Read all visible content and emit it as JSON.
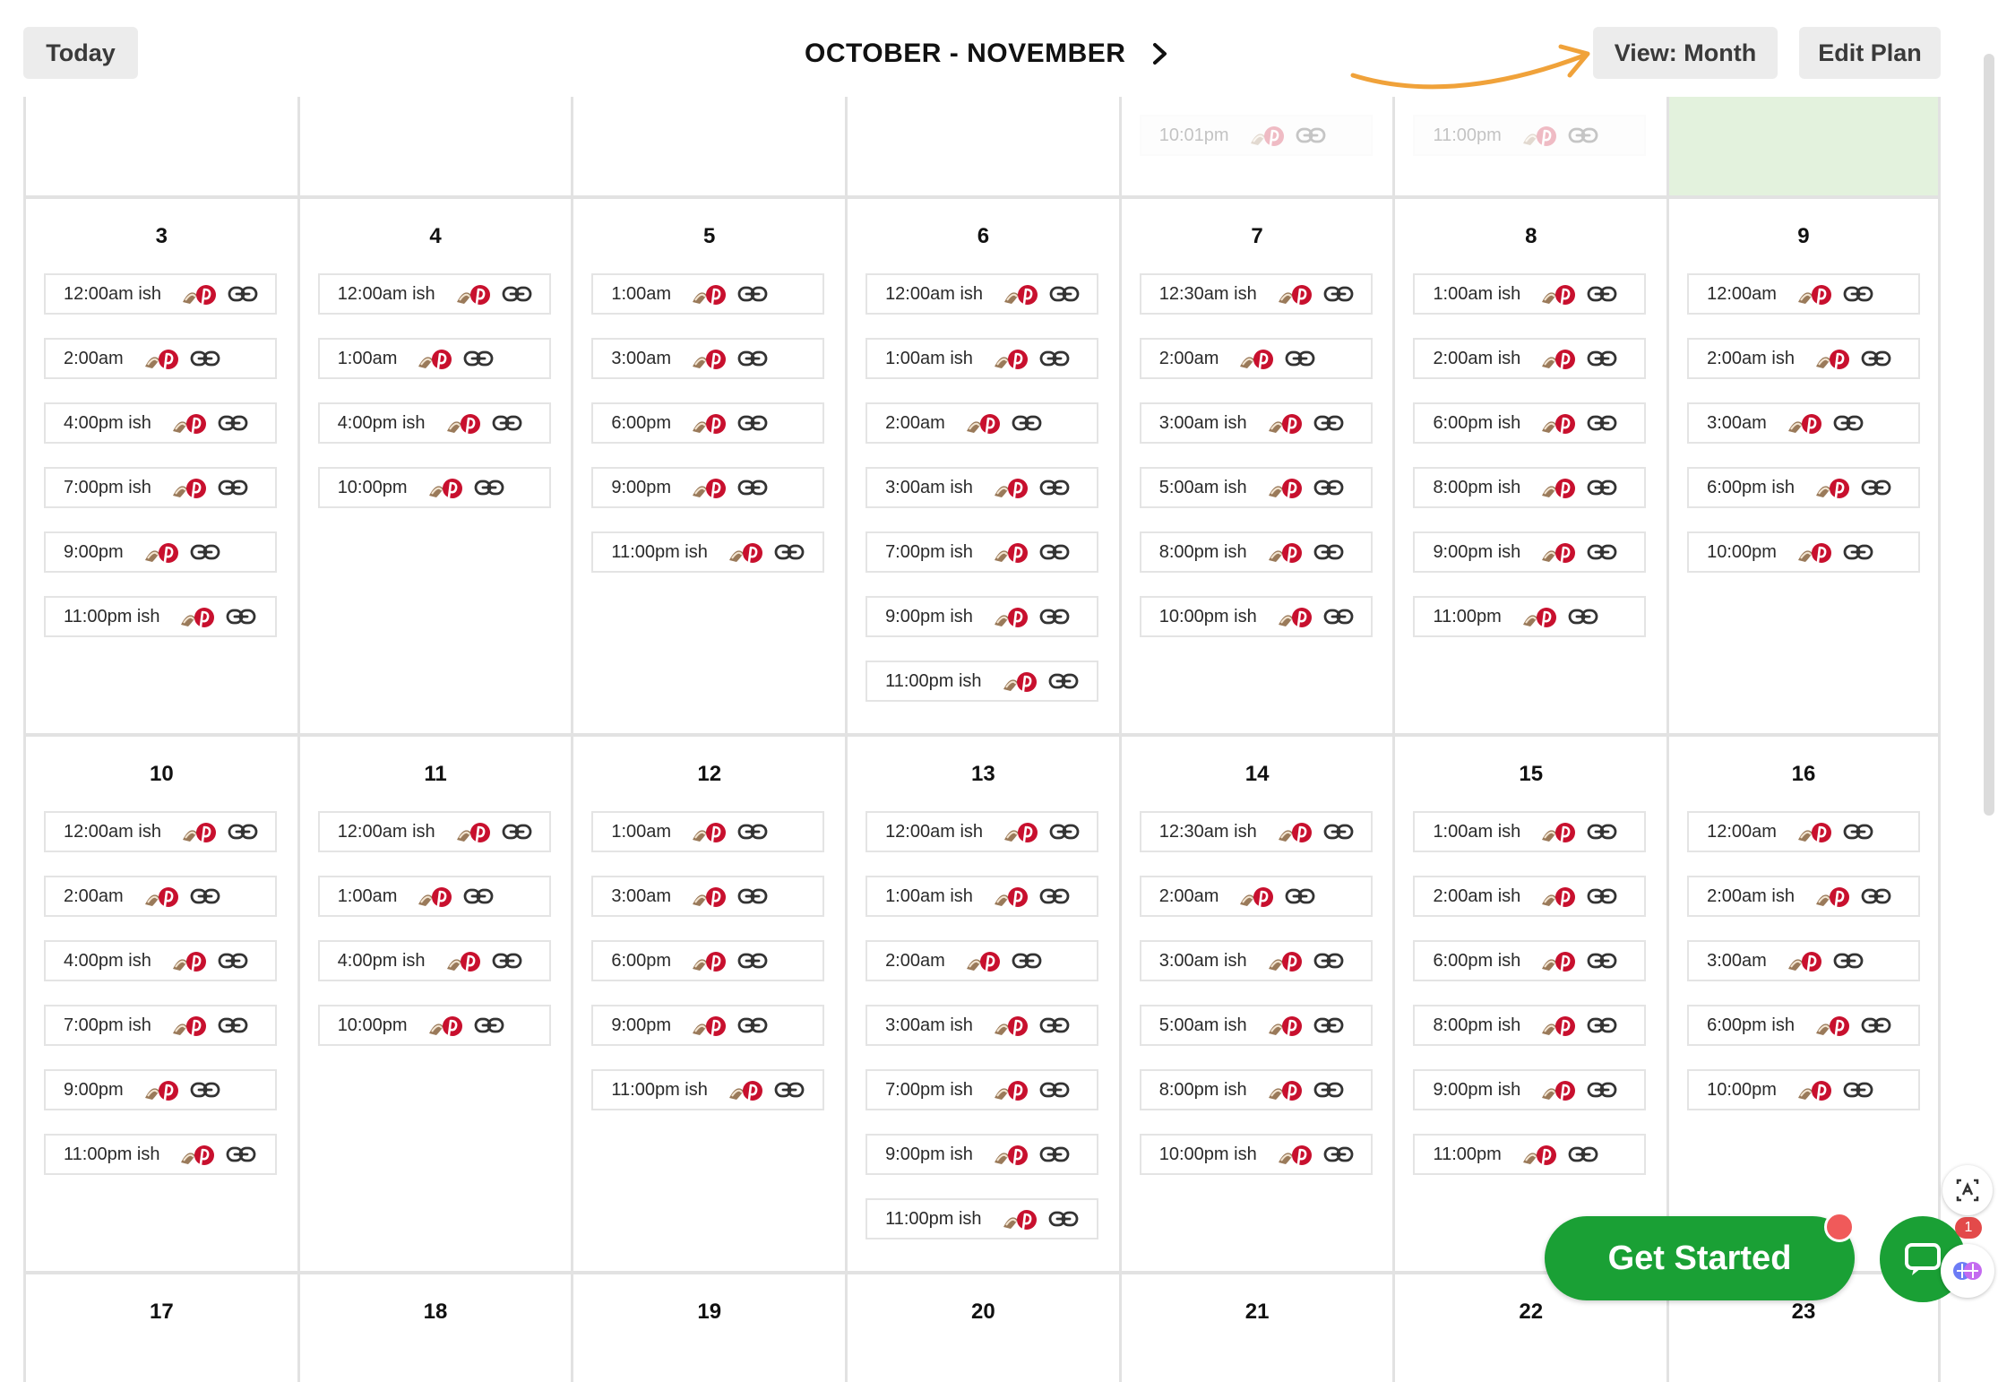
{
  "toolbar": {
    "today_label": "Today",
    "range_title": "OCTOBER - NOVEMBER",
    "view_label": "View: Month",
    "edit_label": "Edit Plan"
  },
  "colors": {
    "accent_green": "#1aa035",
    "annotation_arrow": "#f0a23a",
    "pin_red": "#c8102e",
    "today_bg": "#e3f2dd"
  },
  "calendar": {
    "weeks": [
      {
        "days": [
          {
            "num": "",
            "slots": []
          },
          {
            "num": "",
            "slots": []
          },
          {
            "num": "",
            "slots": []
          },
          {
            "num": "",
            "slots": []
          },
          {
            "num": "",
            "faded": true,
            "slots": [
              "10:01pm"
            ]
          },
          {
            "num": "",
            "faded": true,
            "slots": [
              "11:00pm"
            ]
          },
          {
            "num": "",
            "today": true,
            "slots": []
          }
        ]
      },
      {
        "days": [
          {
            "num": "3",
            "slots": [
              "12:00am ish",
              "2:00am",
              "4:00pm ish",
              "7:00pm ish",
              "9:00pm",
              "11:00pm ish"
            ]
          },
          {
            "num": "4",
            "slots": [
              "12:00am ish",
              "1:00am",
              "4:00pm ish",
              "10:00pm"
            ]
          },
          {
            "num": "5",
            "slots": [
              "1:00am",
              "3:00am",
              "6:00pm",
              "9:00pm",
              "11:00pm ish"
            ]
          },
          {
            "num": "6",
            "slots": [
              "12:00am ish",
              "1:00am ish",
              "2:00am",
              "3:00am ish",
              "7:00pm ish",
              "9:00pm ish",
              "11:00pm ish"
            ]
          },
          {
            "num": "7",
            "slots": [
              "12:30am ish",
              "2:00am",
              "3:00am ish",
              "5:00am ish",
              "8:00pm ish",
              "10:00pm ish"
            ]
          },
          {
            "num": "8",
            "slots": [
              "1:00am ish",
              "2:00am ish",
              "6:00pm ish",
              "8:00pm ish",
              "9:00pm ish",
              "11:00pm"
            ]
          },
          {
            "num": "9",
            "slots": [
              "12:00am",
              "2:00am ish",
              "3:00am",
              "6:00pm ish",
              "10:00pm"
            ]
          }
        ]
      },
      {
        "days": [
          {
            "num": "10",
            "slots": [
              "12:00am ish",
              "2:00am",
              "4:00pm ish",
              "7:00pm ish",
              "9:00pm",
              "11:00pm ish"
            ]
          },
          {
            "num": "11",
            "slots": [
              "12:00am ish",
              "1:00am",
              "4:00pm ish",
              "10:00pm"
            ]
          },
          {
            "num": "12",
            "slots": [
              "1:00am",
              "3:00am",
              "6:00pm",
              "9:00pm",
              "11:00pm ish"
            ]
          },
          {
            "num": "13",
            "slots": [
              "12:00am ish",
              "1:00am ish",
              "2:00am",
              "3:00am ish",
              "7:00pm ish",
              "9:00pm ish",
              "11:00pm ish"
            ]
          },
          {
            "num": "14",
            "slots": [
              "12:30am ish",
              "2:00am",
              "3:00am ish",
              "5:00am ish",
              "8:00pm ish",
              "10:00pm ish"
            ]
          },
          {
            "num": "15",
            "slots": [
              "1:00am ish",
              "2:00am ish",
              "6:00pm ish",
              "8:00pm ish",
              "9:00pm ish",
              "11:00pm"
            ]
          },
          {
            "num": "16",
            "slots": [
              "12:00am",
              "2:00am ish",
              "3:00am",
              "6:00pm ish",
              "10:00pm"
            ]
          }
        ]
      },
      {
        "days": [
          {
            "num": "17",
            "slots": []
          },
          {
            "num": "18",
            "slots": []
          },
          {
            "num": "19",
            "slots": []
          },
          {
            "num": "20",
            "slots": []
          },
          {
            "num": "21",
            "slots": []
          },
          {
            "num": "22",
            "slots": []
          },
          {
            "num": "23",
            "slots": []
          }
        ]
      }
    ]
  },
  "cta": {
    "get_started_label": "Get Started",
    "chat_badge": "1"
  }
}
